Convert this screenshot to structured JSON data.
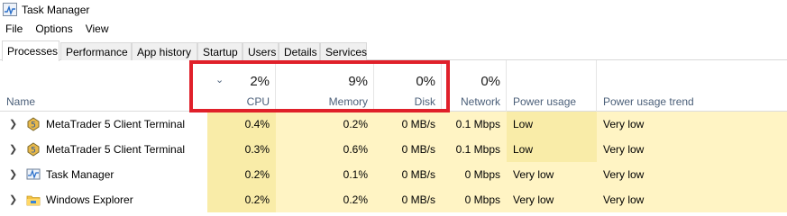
{
  "window": {
    "title": "Task Manager",
    "icon": "task-manager-icon"
  },
  "menu": [
    "File",
    "Options",
    "View"
  ],
  "tabs": [
    "Processes",
    "Performance",
    "App history",
    "Startup",
    "Users",
    "Details",
    "Services"
  ],
  "active_tab": "Processes",
  "columns": {
    "name": "Name",
    "cpu": {
      "pct": "2%",
      "label": "CPU"
    },
    "memory": {
      "pct": "9%",
      "label": "Memory"
    },
    "disk": {
      "pct": "0%",
      "label": "Disk"
    },
    "network": {
      "pct": "0%",
      "label": "Network"
    },
    "power": "Power usage",
    "power_trend": "Power usage trend",
    "sort_indicator": "⌄"
  },
  "rows": [
    {
      "name": "MetaTrader 5 Client Terminal",
      "icon": "metatrader-icon",
      "cpu": "0.4%",
      "memory": "0.2%",
      "disk": "0 MB/s",
      "network": "0.1 Mbps",
      "power": "Low",
      "trend": "Very low"
    },
    {
      "name": "MetaTrader 5 Client Terminal",
      "icon": "metatrader-icon",
      "cpu": "0.3%",
      "memory": "0.6%",
      "disk": "0 MB/s",
      "network": "0.1 Mbps",
      "power": "Low",
      "trend": "Very low"
    },
    {
      "name": "Task Manager",
      "icon": "task-manager-icon",
      "cpu": "0.2%",
      "memory": "0.1%",
      "disk": "0 MB/s",
      "network": "0 Mbps",
      "power": "Very low",
      "trend": "Very low"
    },
    {
      "name": "Windows Explorer",
      "icon": "folder-icon",
      "cpu": "0.2%",
      "memory": "0.2%",
      "disk": "0 MB/s",
      "network": "0 Mbps",
      "power": "Very low",
      "trend": "Very low"
    }
  ],
  "colors": {
    "heat_light": "#fff4c4",
    "heat_medium": "#f9eca8",
    "highlight_box": "#e0202a",
    "header_label": "#4c607a"
  }
}
